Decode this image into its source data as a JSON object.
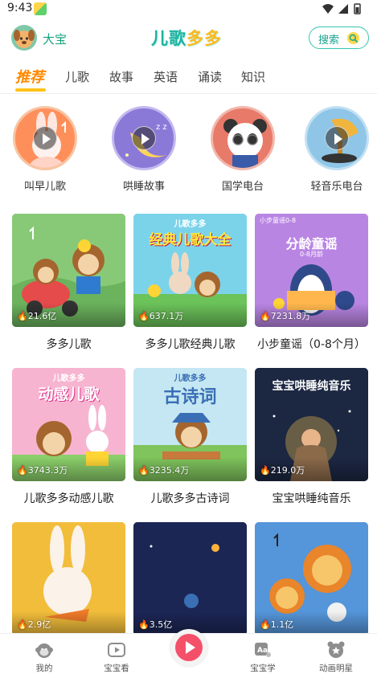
{
  "status_bar": {
    "time": "9:43"
  },
  "header": {
    "username": "大宝",
    "logo_part1": "儿歌",
    "logo_part2": "多多",
    "search_label": "搜索"
  },
  "tabs": [
    "推荐",
    "儿歌",
    "故事",
    "英语",
    "诵读",
    "知识"
  ],
  "circles": [
    {
      "label": "叫早儿歌"
    },
    {
      "label": "哄睡故事"
    },
    {
      "label": "国学电台"
    },
    {
      "label": "轻音乐电台"
    }
  ],
  "cards": [
    {
      "title": "多多儿歌",
      "count": "21.6亿"
    },
    {
      "title": "多多儿歌经典儿歌",
      "count": "637.1万",
      "thumb_top": "儿歌多多",
      "thumb_main": "经典儿歌大全"
    },
    {
      "title": "小步童谣（0-8个月）",
      "count": "7231.8万",
      "thumb_top": "小步童谣0-8",
      "thumb_main": "分龄童谣",
      "thumb_sub": "0-8月龄"
    },
    {
      "title": "儿歌多多动感儿歌",
      "count": "3743.3万",
      "thumb_top": "儿歌多多",
      "thumb_main": "动感儿歌"
    },
    {
      "title": "儿歌多多古诗词",
      "count": "3235.4万",
      "thumb_top": "儿歌多多",
      "thumb_main": "古诗词"
    },
    {
      "title": "宝宝哄睡纯音乐",
      "count": "219.0万",
      "thumb_main": "宝宝哄睡纯音乐"
    },
    {
      "title": "",
      "count": "2.9亿"
    },
    {
      "title": "",
      "count": "3.5亿"
    },
    {
      "title": "",
      "count": "1.1亿"
    }
  ],
  "bottom_nav": [
    {
      "label": "我的"
    },
    {
      "label": "宝宝看"
    },
    {
      "label": "宝宝学"
    },
    {
      "label": "动画明星"
    }
  ],
  "colors": {
    "accent_teal": "#1db3a0",
    "tab_active": "#ff8a00",
    "tab_underline": "#ffc21a",
    "center_play": "#f5506a"
  }
}
